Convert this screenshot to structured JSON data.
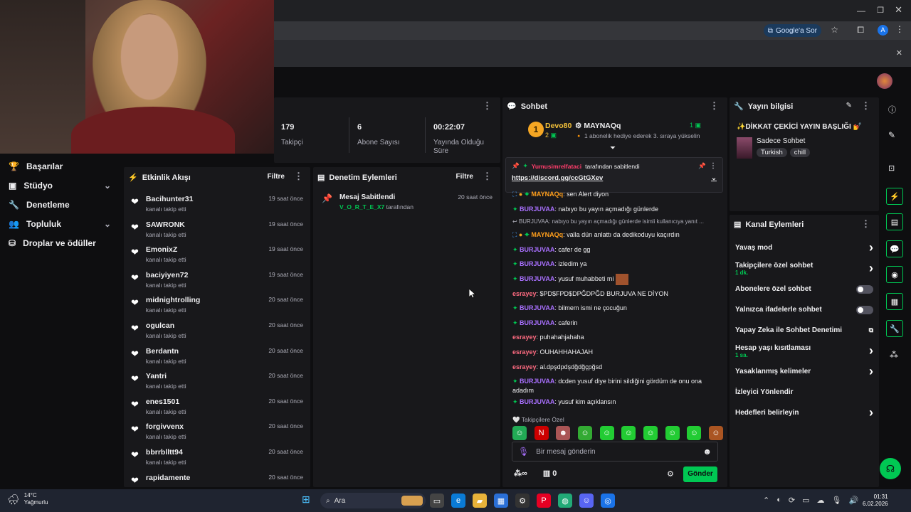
{
  "browser": {
    "google_btn": "Google'a Sor",
    "avatar_letter": "A"
  },
  "stats": [
    {
      "value": "179",
      "label": "Takipçi"
    },
    {
      "value": "6",
      "label": "Abone Sayısı"
    },
    {
      "value": "00:22:07",
      "label": "Yayında Olduğu Süre"
    }
  ],
  "sidebar": {
    "items": [
      {
        "label": "Başarılar",
        "icon": "trophy-icon"
      },
      {
        "label": "Stüdyo",
        "icon": "studio-icon"
      },
      {
        "label": "Denetleme",
        "icon": "wrench-icon"
      },
      {
        "label": "Topluluk",
        "icon": "community-icon"
      },
      {
        "label": "Droplar ve ödüller",
        "icon": "drops-icon"
      }
    ]
  },
  "activity": {
    "title": "Etkinlik Akışı",
    "filter": "Filtre",
    "items": [
      {
        "name": "Bacihunter31",
        "sub": "kanalı takip etti",
        "time": "19 saat önce"
      },
      {
        "name": "SAWRONK",
        "sub": "kanalı takip etti",
        "time": "19 saat önce"
      },
      {
        "name": "EmonixZ",
        "sub": "kanalı takip etti",
        "time": "19 saat önce"
      },
      {
        "name": "baciyiyen72",
        "sub": "kanalı takip etti",
        "time": "19 saat önce"
      },
      {
        "name": "midnightrolling",
        "sub": "kanalı takip etti",
        "time": "20 saat önce"
      },
      {
        "name": "ogulcan",
        "sub": "kanalı takip etti",
        "time": "20 saat önce"
      },
      {
        "name": "Berdantn",
        "sub": "kanalı takip etti",
        "time": "20 saat önce"
      },
      {
        "name": "Yantri",
        "sub": "kanalı takip etti",
        "time": "20 saat önce"
      },
      {
        "name": "enes1501",
        "sub": "kanalı takip etti",
        "time": "20 saat önce"
      },
      {
        "name": "forgivvenx",
        "sub": "kanalı takip etti",
        "time": "20 saat önce"
      },
      {
        "name": "bbrrblltt94",
        "sub": "kanalı takip etti",
        "time": "20 saat önce"
      },
      {
        "name": "rapidamente",
        "sub": "",
        "time": "20 saat önce"
      }
    ]
  },
  "moderation": {
    "title": "Denetim Eylemleri",
    "filter": "Filtre",
    "item_title": "Mesaj Sabitlendi",
    "item_user": "V_O_R_T_E_X7",
    "item_suffix": "tarafından",
    "item_time": "20 saat önce"
  },
  "chat": {
    "title": "Sohbet",
    "leader1": {
      "name": "Devo80",
      "count": "2",
      "rank": "1"
    },
    "leader2": {
      "name": "MAYNAQq",
      "count": "1",
      "desc": "1 abonelik hediye ederek 3. sıraya yükselin"
    },
    "pinned": {
      "by": "Yumusimrelfataci",
      "suffix": "tarafından sabitlendi",
      "link": "https://discord.gg/ccGtGXev"
    },
    "messages": [
      {
        "user": "MAYNAQq",
        "text": ": sen Alert diyon",
        "kind": "mayn"
      },
      {
        "user": "BURJUVAA",
        "text": ": nabıyo bu yayın açmadığı günlerde",
        "kind": "burj"
      },
      {
        "user": "",
        "text": "BURJUVAA: nabıyo bu yayın açmadığı günlerde isimli kullanıcıya yanıt ...",
        "kind": "reply"
      },
      {
        "user": "MAYNAQq",
        "text": ": valla dün anlattı da dedikoduyu kaçırdın",
        "kind": "mayn"
      },
      {
        "user": "BURJUVAA",
        "text": ": cafer de gg",
        "kind": "burj"
      },
      {
        "user": "BURJUVAA",
        "text": ": izledim ya",
        "kind": "burj"
      },
      {
        "user": "BURJUVAA",
        "text": ": yusuf muhabbeti mi",
        "kind": "burj"
      },
      {
        "user": "esrayey",
        "text": ": $PD$FPD$DPĞDPĞD BURJUVA NE DİYON",
        "kind": "esra"
      },
      {
        "user": "BURJUVAA",
        "text": ": bilmem ismi ne çocuğun",
        "kind": "burj"
      },
      {
        "user": "BURJUVAA",
        "text": ": caferin",
        "kind": "burj"
      },
      {
        "user": "esrayey",
        "text": ": puhahahjahaha",
        "kind": "esra"
      },
      {
        "user": "esrayey",
        "text": ": OUHAHHAHAJAH",
        "kind": "esra"
      },
      {
        "user": "esrayey",
        "text": ": al.dpşdpdşdğdğçpğsd",
        "kind": "esra"
      },
      {
        "user": "BURJUVAA",
        "text": ": dcden yusuf diye birini sildiğini gördüm de onu ona",
        "kind": "burj"
      },
      {
        "user": "",
        "text": "adadım",
        "kind": "cont"
      },
      {
        "user": "BURJUVAA",
        "text": ": yusuf kim açıklansın",
        "kind": "burj"
      }
    ],
    "followers_only": "Takipçilere Özel",
    "input_placeholder": "Bir mesaj gönderin",
    "points": "0",
    "send": "Gönder"
  },
  "stream_info": {
    "title": "Yayın bilgisi",
    "stream_title": "✨DİKKAT ÇEKİCİ YAYIN BAŞLIĞI 💅",
    "category": "Sadece Sohbet",
    "tags": [
      "Turkish",
      "chill"
    ]
  },
  "channel_actions": {
    "title": "Kanal Eylemleri",
    "items": [
      {
        "label": "Yavaş mod",
        "sub": "",
        "ctrl": "chev"
      },
      {
        "label": "Takipçilere özel sohbet",
        "sub": "1 dk.",
        "ctrl": "chev"
      },
      {
        "label": "Abonelere özel sohbet",
        "sub": "",
        "ctrl": "toggle"
      },
      {
        "label": "Yalnızca ifadelerle sohbet",
        "sub": "",
        "ctrl": "toggle"
      },
      {
        "label": "Yapay Zeka ile Sohbet Denetimi",
        "sub": "",
        "ctrl": "ext"
      },
      {
        "label": "Hesap yaşı kısıtlaması",
        "sub": "1 sa.",
        "ctrl": "chev"
      },
      {
        "label": "Yasaklanmış kelimeler",
        "sub": "",
        "ctrl": "chev"
      },
      {
        "label": "İzleyici Yönlendir",
        "sub": "",
        "ctrl": ""
      },
      {
        "label": "Hedefleri belirleyin",
        "sub": "",
        "ctrl": "chev"
      }
    ]
  },
  "taskbar": {
    "temp": "14°C",
    "weather": "Yağmurlu",
    "search": "Ara",
    "time": "01:31",
    "date": "6.02.2026"
  },
  "colors": {
    "accent": "#00c853",
    "panel": "#18181b",
    "bg": "#0e0e10"
  }
}
